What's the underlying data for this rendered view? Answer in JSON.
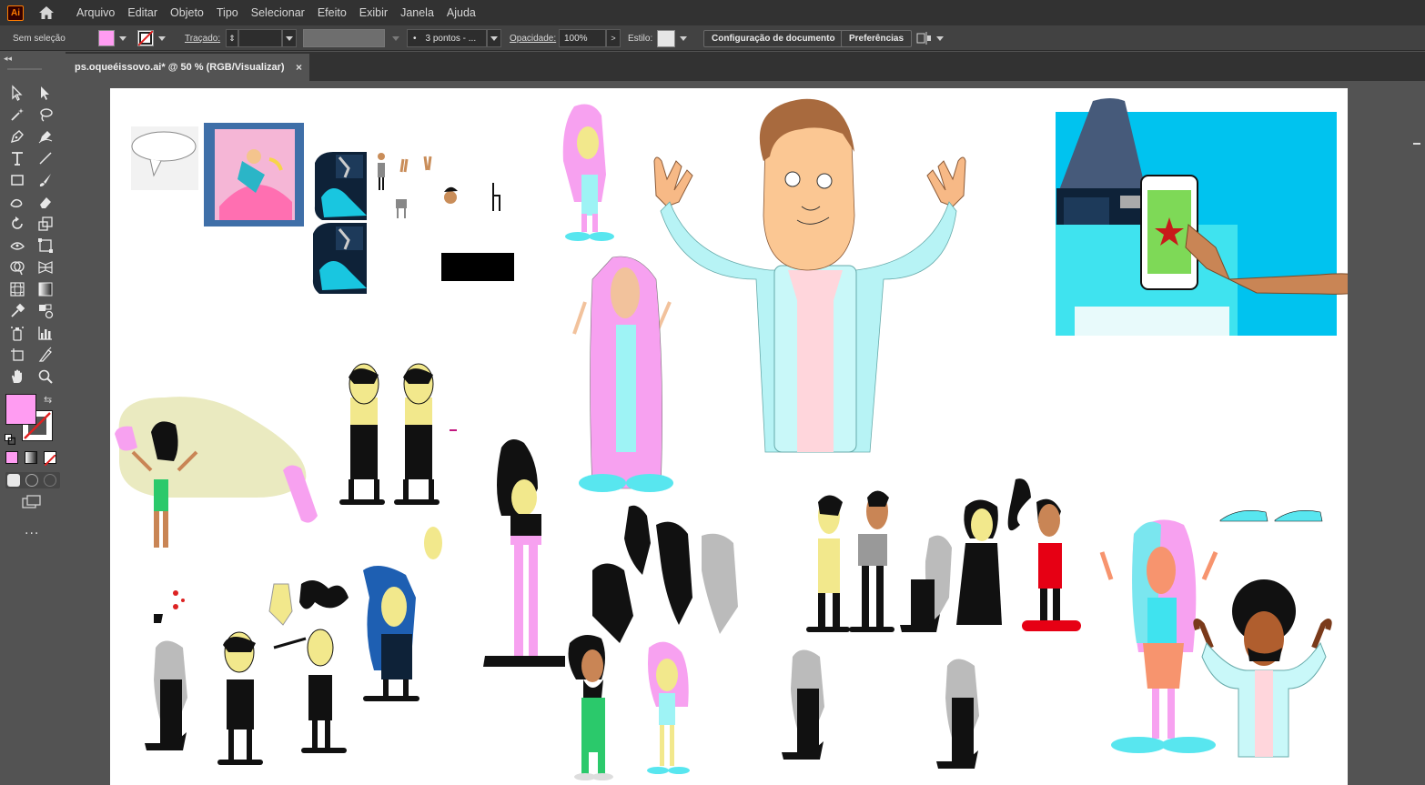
{
  "app": {
    "logo_text": "Ai"
  },
  "menu": {
    "items": [
      "Arquivo",
      "Editar",
      "Objeto",
      "Tipo",
      "Selecionar",
      "Efeito",
      "Exibir",
      "Janela",
      "Ajuda"
    ]
  },
  "control_bar": {
    "selection_status": "Sem seleção",
    "stroke_label": "Traçado:",
    "brush_value": "3 pontos - ...",
    "opacity_label": "Opacidade:",
    "opacity_value": "100%",
    "style_label": "Estilo:",
    "doc_setup_button": "Configuração de documento",
    "preferences_button": "Preferências",
    "fill_color": "#ff9cf2",
    "stroke_color": "none"
  },
  "document_tab": {
    "title": "ps.oqueéissovo.ai* @ 50 % (RGB/Visualizar)",
    "close": "×"
  },
  "toolbar": {
    "tools": [
      "selection",
      "direct-selection",
      "magic-wand",
      "lasso",
      "pen",
      "curvature",
      "type",
      "line",
      "rectangle",
      "paintbrush",
      "shaper",
      "eraser",
      "rotate",
      "scale",
      "width",
      "free-transform",
      "shape-builder",
      "perspective-grid",
      "mesh",
      "gradient",
      "eyedropper",
      "blend",
      "symbol-sprayer",
      "column-graph",
      "artboard",
      "slice",
      "hand",
      "zoom"
    ],
    "more": "..."
  },
  "colors": {
    "accent_fill": "#ff9cf2",
    "panel": "#535353",
    "menubar": "#323232"
  }
}
